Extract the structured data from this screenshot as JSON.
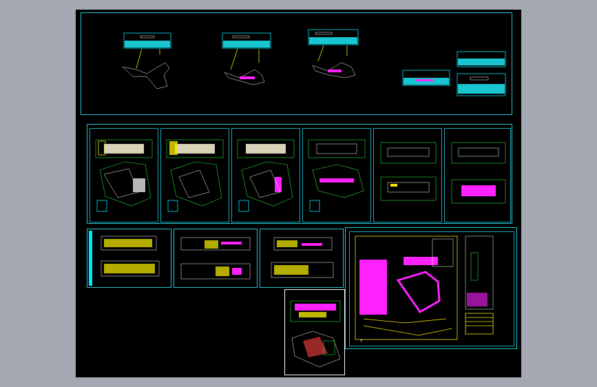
{
  "app": {
    "title": "",
    "background": "#a4a8b2",
    "canvas_color": "#000000",
    "accent_cyan": "#22c8d8",
    "accent_yellow": "#f2e600",
    "accent_green": "#2be03a",
    "accent_magenta": "#ff22ff"
  },
  "labels": {
    "details": "",
    "site": "",
    "stair": ""
  },
  "icons": {
    "north_arrow": "north-arrow-icon"
  }
}
